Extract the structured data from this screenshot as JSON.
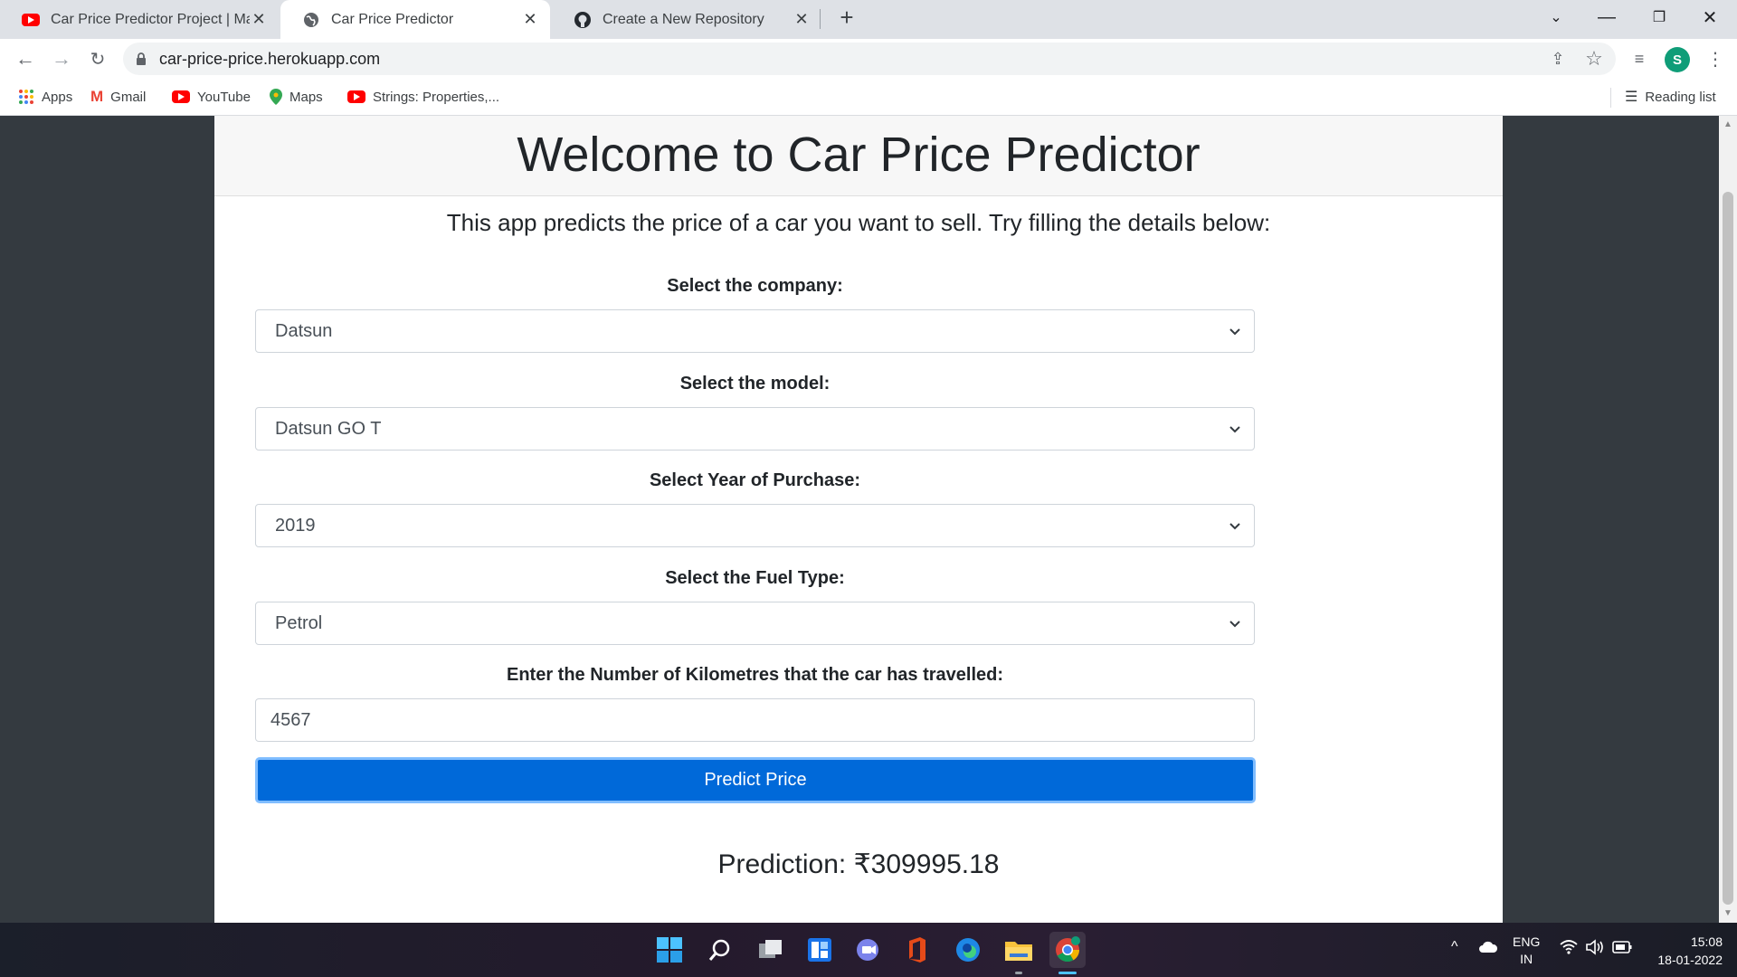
{
  "browser": {
    "tabs": [
      {
        "title": "Car Price Predictor Project | Machine Learning",
        "favicon": "youtube-icon",
        "active": false
      },
      {
        "title": "Car Price Predictor",
        "favicon": "globe-icon",
        "active": true
      },
      {
        "title": "Create a New Repository",
        "favicon": "github-icon",
        "active": false
      }
    ],
    "url": "car-price-price.herokuapp.com",
    "profile_initial": "S",
    "bookmarks": [
      {
        "label": "Apps",
        "icon": "apps-grid-icon"
      },
      {
        "label": "Gmail",
        "icon": "gmail-icon"
      },
      {
        "label": "YouTube",
        "icon": "youtube-icon"
      },
      {
        "label": "Maps",
        "icon": "maps-pin-icon"
      },
      {
        "label": "Strings: Properties,...",
        "icon": "youtube-icon"
      }
    ],
    "reading_list": "Reading list"
  },
  "page": {
    "heading": "Welcome to Car Price Predictor",
    "intro": "This app predicts the price of a car you want to sell. Try filling the details below:",
    "fields": {
      "company": {
        "label": "Select the company:",
        "value": "Datsun"
      },
      "model": {
        "label": "Select the model:",
        "value": "Datsun GO T"
      },
      "year": {
        "label": "Select Year of Purchase:",
        "value": "2019"
      },
      "fuel": {
        "label": "Select the Fuel Type:",
        "value": "Petrol"
      },
      "km": {
        "label": "Enter the Number of Kilometres that the car has travelled:",
        "value": "4567"
      }
    },
    "predict_button": "Predict Price",
    "prediction": "Prediction: ₹309995.18"
  },
  "taskbar": {
    "language": "ENG",
    "region": "IN",
    "time": "15:08",
    "date": "18-01-2022"
  },
  "colors": {
    "primary_button": "#0069d9",
    "page_background": "#343a40",
    "card_header": "#f7f7f7"
  }
}
